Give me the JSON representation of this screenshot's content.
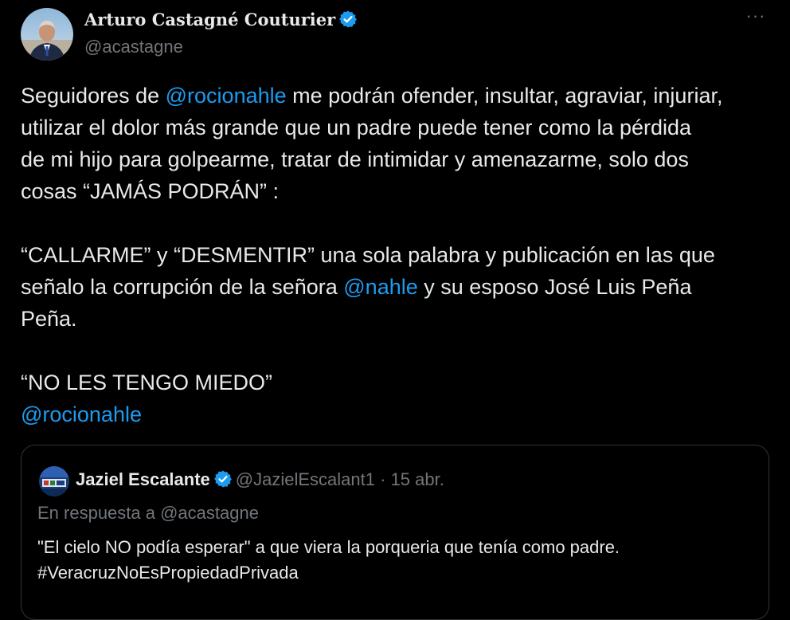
{
  "tweet": {
    "author": {
      "display_name": "Arturo Castagné Couturier",
      "handle": "@acastagne",
      "verified": true
    },
    "more_icon": "more-horizontal-icon",
    "text": {
      "p1_a": "Seguidores de ",
      "p1_mention": "@rocionahle",
      "p1_b": " me podrán ofender, insultar, agraviar, injuriar,",
      "p1_line2": "utilizar el dolor más grande que un padre puede tener como la pérdida",
      "p1_line3": "de mi hijo para golpearme, tratar de intimidar y amenazarme, solo dos",
      "p1_line4": "cosas “JAMÁS PODRÁN” :",
      "p2_line1": "“CALLARME” y “DESMENTIR” una sola palabra y publicación en las que",
      "p2_a": "señalo la corrupción de la señora ",
      "p2_mention": "@nahle",
      "p2_b": " y su esposo José Luis Peña",
      "p2_line3": "Peña.",
      "p3_line1": "“NO LES TENGO MIEDO”",
      "p3_mention": "@rocionahle"
    }
  },
  "quoted_tweet": {
    "display_name": "Jaziel Escalante",
    "handle": "@JazielEscalant1",
    "separator": "·",
    "date": "15 abr.",
    "reply_to": "En respuesta a @acastagne",
    "text_line1": "\"El cielo NO podía esperar\" a que viera la porqueria que tenía como padre.",
    "text_line2": "#VeracruzNoEsPropiedadPrivada"
  },
  "colors": {
    "background": "#000000",
    "text": "#e7e9ea",
    "secondary": "#71767b",
    "link": "#1d9bf0",
    "border": "#2f3336"
  }
}
